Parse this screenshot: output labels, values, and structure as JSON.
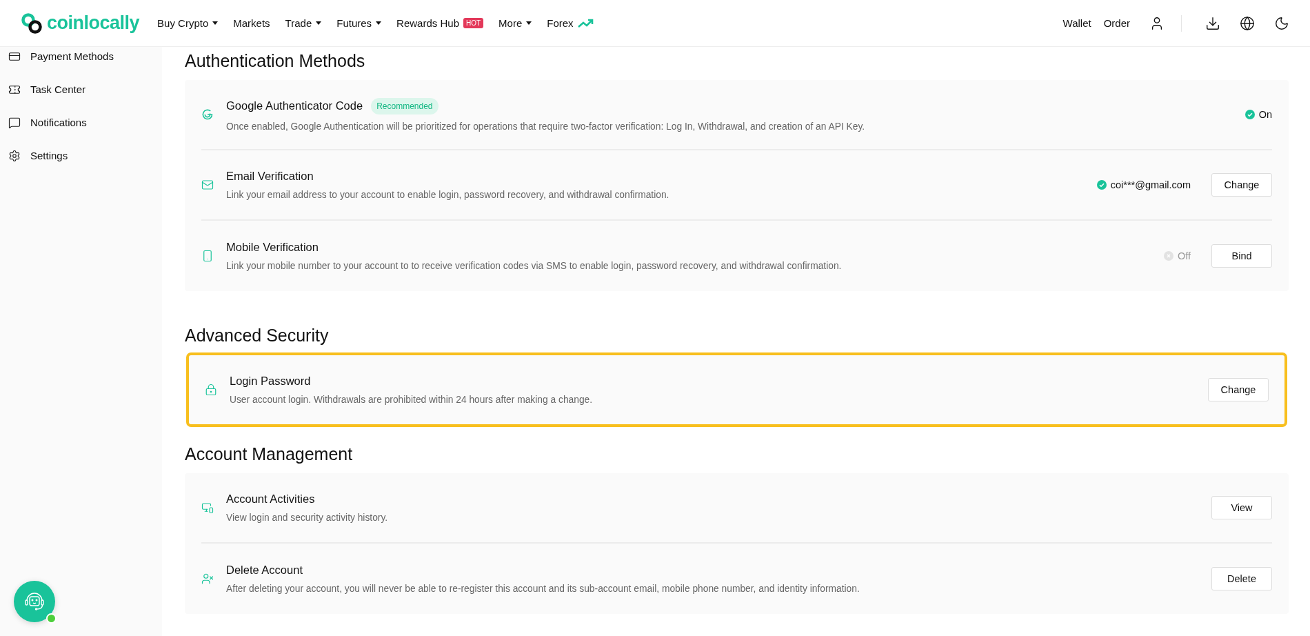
{
  "header": {
    "logo": "coinlocally",
    "nav": [
      {
        "label": "Buy Crypto",
        "caret": true
      },
      {
        "label": "Markets",
        "caret": false
      },
      {
        "label": "Trade",
        "caret": true
      },
      {
        "label": "Futures",
        "caret": true
      },
      {
        "label": "Rewards Hub",
        "caret": false,
        "badge": "HOT"
      },
      {
        "label": "More",
        "caret": true
      },
      {
        "label": "Forex",
        "caret": false,
        "trend": true
      }
    ],
    "right_links": [
      "Wallet",
      "Order"
    ]
  },
  "sidebar": {
    "items": [
      {
        "label": "Payment Methods",
        "kind": "card"
      },
      {
        "label": "Task Center",
        "kind": "ticket"
      },
      {
        "label": "Notifications",
        "kind": "message"
      },
      {
        "label": "Settings",
        "kind": "gear"
      }
    ]
  },
  "sections": [
    {
      "title": "Authentication Methods",
      "highlighted": false,
      "items": [
        {
          "kind": "google",
          "title": "Google Authenticator Code",
          "badge": "Recommended",
          "description": "Once enabled, Google Authentication will be prioritized for operations that require two-factor verification: Log In, Withdrawal, and creation of an API Key.",
          "status": {
            "on": true,
            "text": "On"
          }
        },
        {
          "kind": "mail",
          "title": "Email Verification",
          "description": "Link your email address to your account to enable login, password recovery, and withdrawal confirmation.",
          "status": {
            "on": true,
            "text": "coi***@gmail.com"
          },
          "button": "Change"
        },
        {
          "kind": "phone",
          "title": "Mobile Verification",
          "description": "Link your mobile number to your account to to receive verification codes via SMS to enable login, password recovery, and withdrawal confirmation.",
          "status": {
            "on": false,
            "text": "Off"
          },
          "button": "Bind"
        }
      ]
    },
    {
      "title": "Advanced Security",
      "highlighted": true,
      "items": [
        {
          "kind": "lock",
          "title": "Login Password",
          "description": "User account login. Withdrawals are prohibited within 24 hours after making a change.",
          "button": "Change"
        }
      ]
    },
    {
      "title": "Account Management",
      "highlighted": false,
      "items": [
        {
          "kind": "devices",
          "title": "Account Activities",
          "description": "View login and security activity history.",
          "button": "View"
        },
        {
          "kind": "user-x",
          "title": "Delete Account",
          "description": "After deleting your account, you will never be able to re-register this account and its sub-account email, mobile phone number, and identity information.",
          "button": "Delete"
        }
      ]
    }
  ]
}
